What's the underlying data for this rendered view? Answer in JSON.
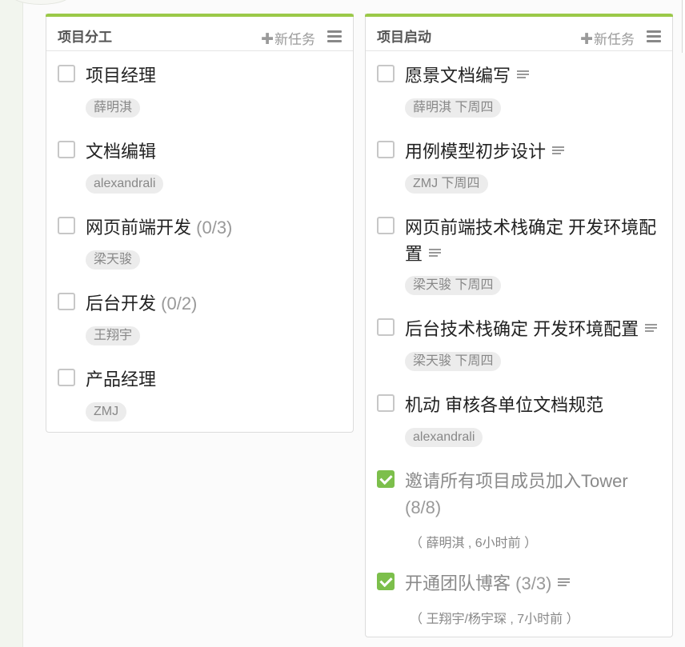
{
  "lists": [
    {
      "title": "项目分工",
      "new_task_label": "新任务",
      "tasks": [
        {
          "title": "项目经理",
          "tag": "薛明淇"
        },
        {
          "title": "文档编辑",
          "tag": "alexandrali"
        },
        {
          "title": "网页前端开发",
          "count": "(0/3)",
          "tag": "梁天骏"
        },
        {
          "title": "后台开发",
          "count": "(0/2)",
          "tag": "王翔宇"
        },
        {
          "title": "产品经理",
          "tag": "ZMJ"
        }
      ]
    },
    {
      "title": "项目启动",
      "new_task_label": "新任务",
      "tasks": [
        {
          "title": "愿景文档编写",
          "tag": "薛明淇 下周四"
        },
        {
          "title": "用例模型初步设计",
          "tag": "ZMJ 下周四"
        },
        {
          "title": "网页前端技术栈确定 开发环境配置",
          "tag": "梁天骏 下周四"
        },
        {
          "title": "后台技术栈确定 开发环境配置",
          "tag": "梁天骏 下周四"
        },
        {
          "title": "机动 审核各单位文档规范",
          "tag": "alexandrali"
        },
        {
          "title": "邀请所有项目成员加入Tower",
          "count": "(8/8)",
          "meta": "（ 薛明淇 , 6小时前 ）",
          "done": true
        },
        {
          "title": "开通团队博客",
          "count": "(3/3)",
          "meta": "（ 王翔宇/杨宇琛 , 7小时前 ）",
          "done": true
        }
      ]
    }
  ],
  "icons": {
    "plus": "plus-icon",
    "menu": "menu-icon",
    "description": "description-icon",
    "check": "checkmark-icon"
  },
  "colors": {
    "accent": "#9bc948",
    "checked": "#7cbf4b"
  }
}
